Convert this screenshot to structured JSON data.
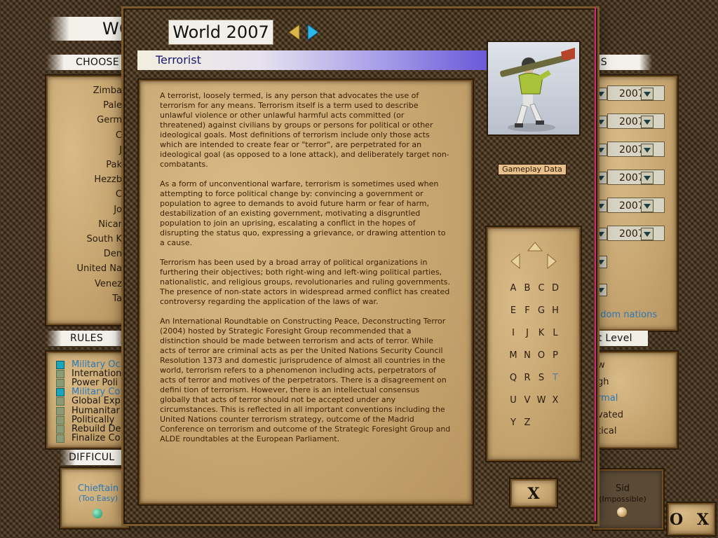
{
  "background": {
    "title_fragment": "WO",
    "choose_label": "CHOOSE",
    "nations_label_fragment": "NS",
    "nations": [
      "Zimba",
      "Pale",
      "Germ",
      "C",
      "J",
      "Pak",
      "Hezzb",
      "C",
      "Jo",
      "Nicar",
      "South K",
      "Den",
      "United Na",
      "Venez",
      "Ta"
    ],
    "rules_label": "RULES",
    "rules": [
      {
        "text": "Military Oc",
        "checked": true,
        "highlight": true
      },
      {
        "text": "Internation",
        "checked": false,
        "highlight": false
      },
      {
        "text": "Power Poli",
        "checked": false,
        "highlight": false
      },
      {
        "text": "Military Co",
        "checked": true,
        "highlight": true
      },
      {
        "text": "Global Exp",
        "checked": false,
        "highlight": false
      },
      {
        "text": "Humanitar",
        "checked": false,
        "highlight": false
      },
      {
        "text": "Politically",
        "checked": false,
        "highlight": false
      },
      {
        "text": "Rebuild De",
        "checked": false,
        "highlight": false
      },
      {
        "text": "Finalize Co",
        "checked": false,
        "highlight": false
      }
    ],
    "difficulty_label": "DIFFICUL",
    "chieftain_label": "Chieftain",
    "chieftain_sub": "(Too Easy)",
    "years": [
      "2007",
      "2007",
      "2007",
      "2007",
      "2007",
      "2007"
    ],
    "random_nations": "ndom nations",
    "threat_label": "at Level",
    "threat_levels": [
      "w",
      "gh",
      "rmal",
      "vated",
      "tical"
    ],
    "sid_label": "Sid",
    "sid_sub": "(Impossible)",
    "ok_cancel": "O X"
  },
  "modal": {
    "title": "World 2007",
    "header": "Terrorist",
    "paragraphs": [
      "A terrorist, loosely termed, is any person that advocates the use of terrorism for any means. Terrorism itself is a term used to describe unlawful violence or other unlawful harmful acts committed (or threatened) against civilians by groups or persons for political or other ideological goals. Most definitions of terrorism include only those acts which are intended to create fear or \"terror\", are perpetrated for an ideological goal (as opposed to a lone attack), and deliberately target non-combatants.",
      "As a form of unconventional warfare, terrorism is sometimes used when attempting to force political change by: convincing a government or population to agree to demands to avoid future harm or fear of harm, destabilization of an existing government, motivating a disgruntled population to join an uprising, escalating a conflict in the hopes of disrupting the status quo, expressing a grievance, or drawing attention to a cause.",
      "Terrorism has been used by a broad array of political organizations in furthering their objectives; both right-wing and left-wing political parties, nationalistic, and religious groups, revolutionaries and ruling governments. The presence of non-state actors in widespread armed conflict has created controversy regarding the application of the laws of war.",
      "An International Roundtable on Constructing Peace, Deconstructing Terror (2004) hosted by Strategic Foresight Group recommended that a distinction should be made between terrorism and acts of terror. While acts of terror are criminal acts as per the United Nations Security Council Resolution 1373 and domestic jurisprudence of almost all countries in the world, terrorism refers to a phenomenon including acts, perpetrators of acts of terror and motives of the perpetrators. There is a disagreement on defini tion of terrorism. However, there is an intellectual consensus globally that acts of terror should not be accepted under any circumstances. This is reflected in all important conventions including the United Nations counter terrorism strategy, outcome of the Madrid Conference on terrorism and outcome of the Strategic Foresight Group and ALDE roundtables at the European Parliament."
    ],
    "gameplay_button": "Gameplay Data",
    "alphabet": [
      [
        "A",
        "B",
        "C",
        "D"
      ],
      [
        "E",
        "F",
        "G",
        "H"
      ],
      [
        "I",
        "J",
        "K",
        "L"
      ],
      [
        "M",
        "N",
        "O",
        "P"
      ],
      [
        "Q",
        "R",
        "S",
        "T"
      ],
      [
        "U",
        "V",
        "W",
        "X"
      ],
      [
        "Y",
        "Z"
      ]
    ],
    "highlighted_letter": "T",
    "close_button": "X"
  },
  "colors": {
    "accent_blue": "#1aa6b8",
    "header_gradient_end": "#6a58d8",
    "divider_pink": "#d6267a"
  }
}
